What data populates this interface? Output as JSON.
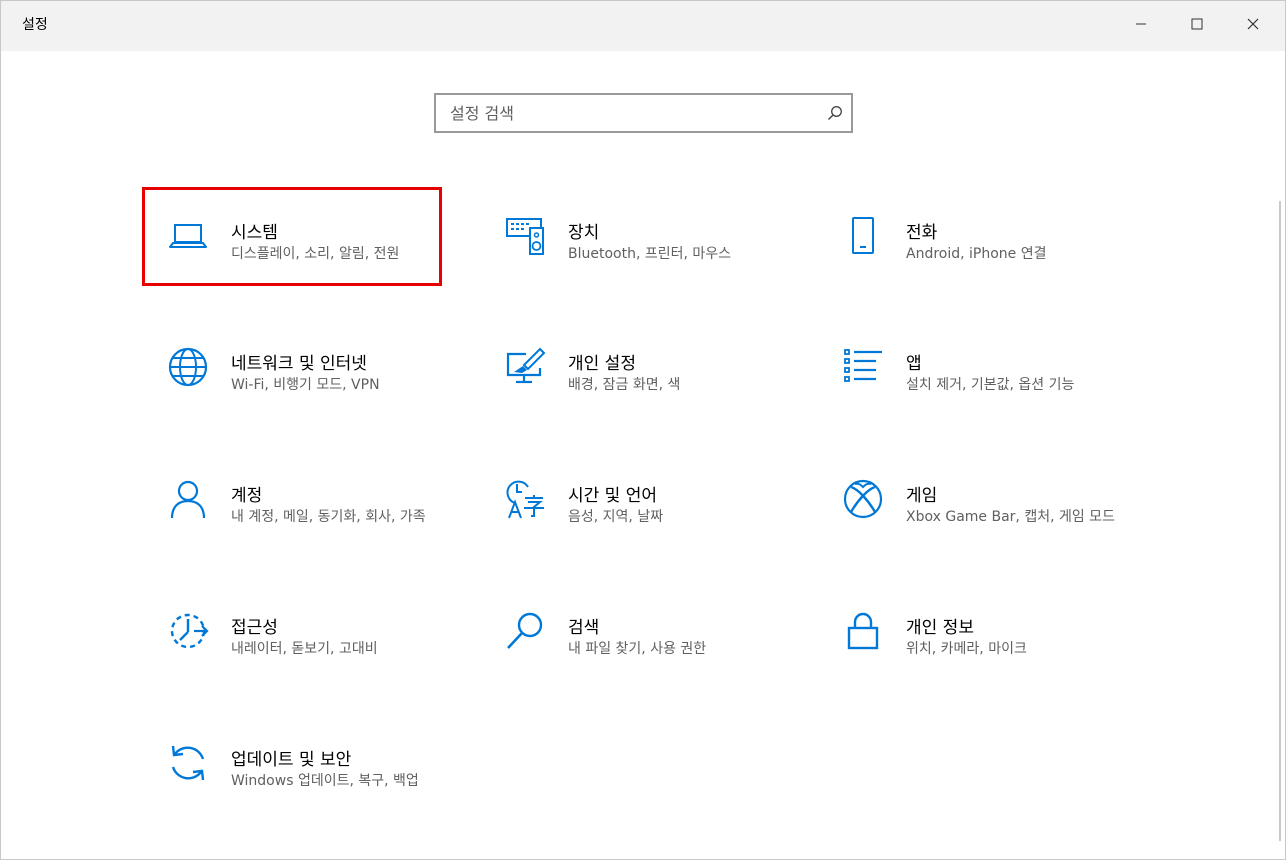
{
  "window": {
    "title": "설정"
  },
  "search": {
    "placeholder": "설정 검색",
    "value": ""
  },
  "colors": {
    "accent": "#0078d7",
    "highlight": "#e60000"
  },
  "tiles": [
    {
      "icon": "laptop-icon",
      "title": "시스템",
      "subtitle": "디스플레이, 소리, 알림, 전원"
    },
    {
      "icon": "keyboard-speaker-icon",
      "title": "장치",
      "subtitle": "Bluetooth, 프린터, 마우스"
    },
    {
      "icon": "phone-icon",
      "title": "전화",
      "subtitle": "Android, iPhone 연결"
    },
    {
      "icon": "globe-icon",
      "title": "네트워크 및 인터넷",
      "subtitle": "Wi-Fi, 비행기 모드, VPN"
    },
    {
      "icon": "paint-monitor-icon",
      "title": "개인 설정",
      "subtitle": "배경, 잠금 화면, 색"
    },
    {
      "icon": "apps-list-icon",
      "title": "앱",
      "subtitle": "설치 제거, 기본값, 옵션 기능"
    },
    {
      "icon": "person-icon",
      "title": "계정",
      "subtitle": "내 계정, 메일, 동기화, 회사, 가족"
    },
    {
      "icon": "time-language-icon",
      "title": "시간 및 언어",
      "subtitle": "음성, 지역, 날짜"
    },
    {
      "icon": "xbox-icon",
      "title": "게임",
      "subtitle": "Xbox Game Bar, 캡처, 게임 모드"
    },
    {
      "icon": "ease-of-access-icon",
      "title": "접근성",
      "subtitle": "내레이터, 돋보기, 고대비"
    },
    {
      "icon": "search-icon",
      "title": "검색",
      "subtitle": "내 파일 찾기, 사용 권한"
    },
    {
      "icon": "lock-icon",
      "title": "개인 정보",
      "subtitle": "위치, 카메라, 마이크"
    },
    {
      "icon": "update-sync-icon",
      "title": "업데이트 및 보안",
      "subtitle": "Windows 업데이트, 복구, 백업"
    }
  ]
}
